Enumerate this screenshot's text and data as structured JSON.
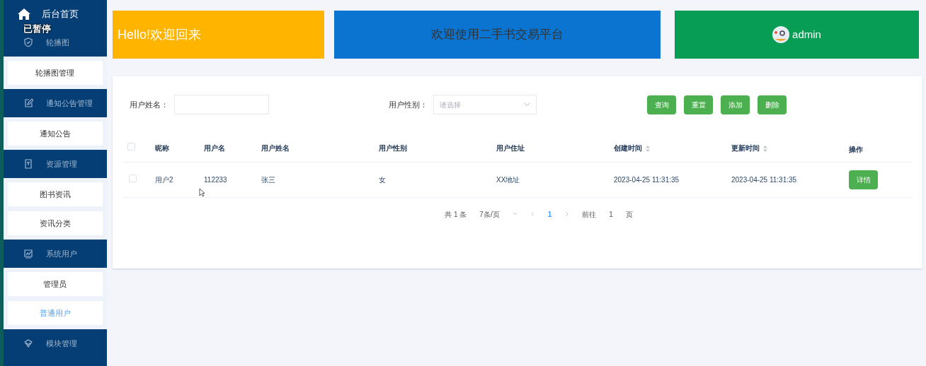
{
  "sidebar": {
    "home": {
      "label": "后台首页"
    },
    "overlay_text": "已暂停",
    "groups": [
      {
        "label": "轮播图",
        "children": [
          {
            "label": "轮播图管理",
            "selected": false
          }
        ]
      },
      {
        "label": "通知公告管理",
        "children": [
          {
            "label": "通知公告",
            "selected": false
          }
        ]
      },
      {
        "label": "资源管理",
        "children": [
          {
            "label": "图书资讯",
            "selected": false
          },
          {
            "label": "资讯分类",
            "selected": false
          }
        ]
      },
      {
        "label": "系统用户",
        "children": [
          {
            "label": "管理员",
            "selected": false
          },
          {
            "label": "普通用户",
            "selected": true
          }
        ]
      },
      {
        "label": "模块管理"
      }
    ]
  },
  "banners": {
    "greeting": "Hello!欢迎回来",
    "welcome": "欢迎使用二手书交易平台",
    "user": "admin"
  },
  "filters": [
    {
      "label": "用户姓名：",
      "kind": "input"
    },
    {
      "label": "用户性别：",
      "kind": "select",
      "placeholder": "请选择"
    }
  ],
  "buttons": [
    "查询",
    "重置",
    "添加",
    "删除"
  ],
  "table": {
    "select_all": {
      "checked": false
    },
    "columns": [
      {
        "label": "昵称",
        "sortable": false
      },
      {
        "label": "用户名",
        "sortable": false
      },
      {
        "label": "用户姓名",
        "sortable": false
      },
      {
        "label": "用户性别",
        "sortable": false
      },
      {
        "label": "用户住址",
        "sortable": false
      },
      {
        "label": "创建时间",
        "sortable": true
      },
      {
        "label": "更新时间",
        "sortable": true
      },
      {
        "label": "操作",
        "sortable": false
      }
    ],
    "rows": [
      {
        "checked": false,
        "cells": [
          "用户2",
          "112233",
          "张三",
          "女",
          "XX地址",
          "2023-04-25 11:31:35",
          "2023-04-25 11:31:35"
        ],
        "action": "详情"
      }
    ]
  },
  "pagination": {
    "total": "共 1 条",
    "page_size": "7条/页",
    "pages": [
      {
        "label": "1",
        "selected": true
      }
    ],
    "goto_label": "前往",
    "goto_value": "1",
    "goto_suffix": "页"
  }
}
